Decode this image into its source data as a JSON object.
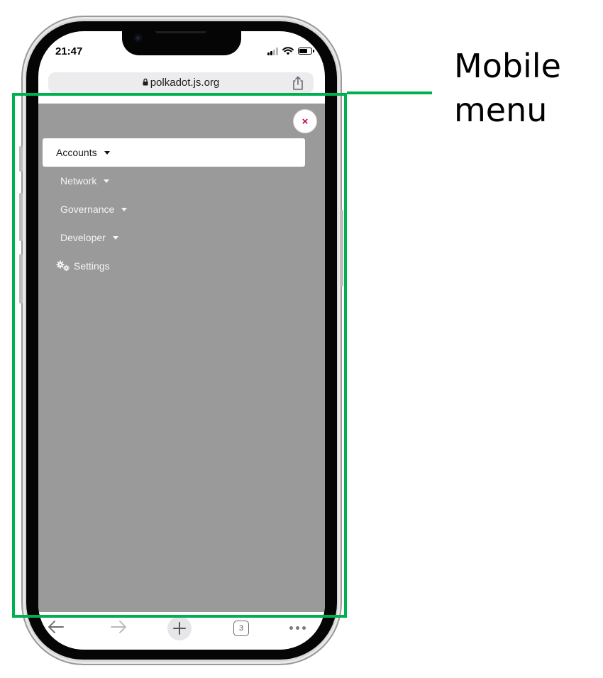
{
  "status_bar": {
    "time": "21:47"
  },
  "browser": {
    "url": "polkadot.js.org",
    "tab_count": "3"
  },
  "menu": {
    "close_symbol": "×",
    "items": [
      {
        "label": "Accounts",
        "active": true,
        "has_dropdown": true
      },
      {
        "label": "Network",
        "active": false,
        "has_dropdown": true
      },
      {
        "label": "Governance",
        "active": false,
        "has_dropdown": true
      },
      {
        "label": "Developer",
        "active": false,
        "has_dropdown": true
      },
      {
        "label": "Settings",
        "active": false,
        "has_dropdown": false,
        "icon": "gears-icon"
      }
    ]
  },
  "annotation": {
    "label": "Mobile menu"
  },
  "colors": {
    "highlight": "#00b050",
    "close_accent": "#c9005c",
    "overlay": "#9a9a9a"
  },
  "icons": {
    "share": "share-icon",
    "back": "back-arrow-icon",
    "forward": "forward-arrow-icon",
    "new_tab": "plus-icon",
    "tabs": "tabs-icon",
    "more": "more-dots-icon"
  }
}
